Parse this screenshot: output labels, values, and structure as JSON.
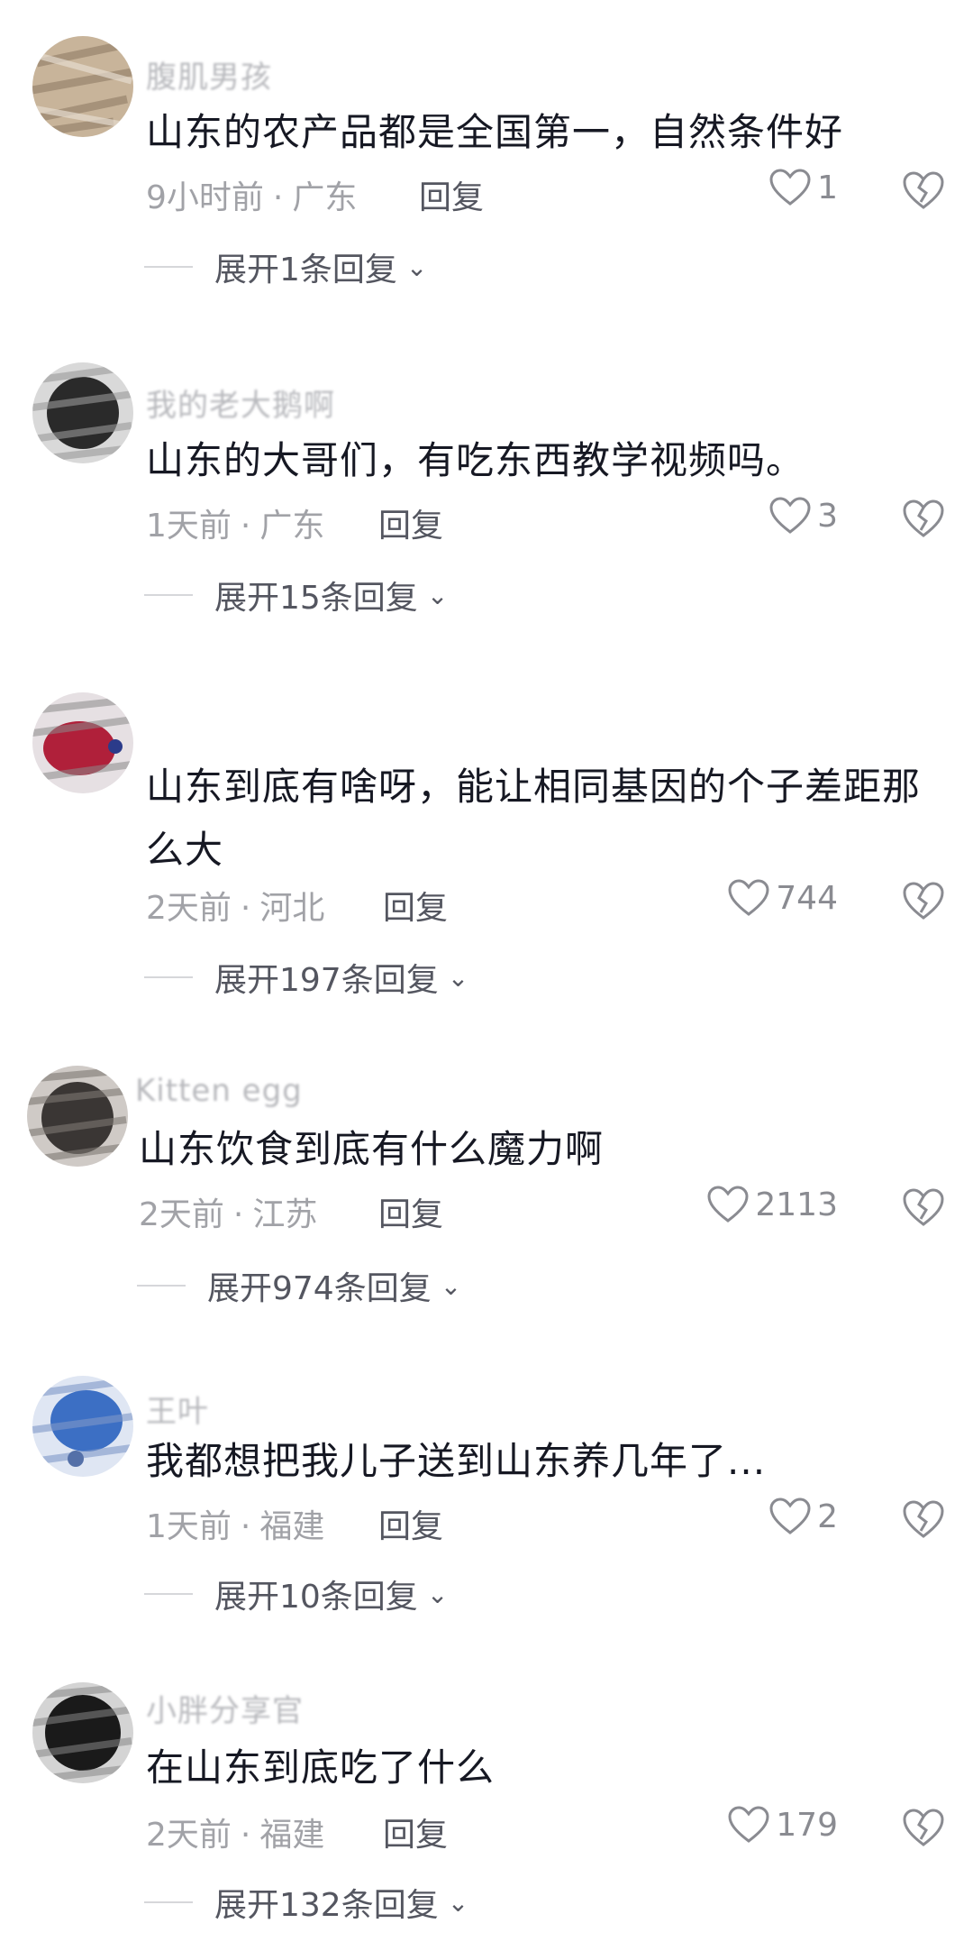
{
  "comments": [
    {
      "username": "腹肌男孩",
      "text": "山东的农产品都是全国第一，自然条件好",
      "time": "9小时前",
      "location": "广东",
      "reply_label": "回复",
      "likes": "1",
      "expand_label": "展开1条回复",
      "avatar_color": "#c8b49a"
    },
    {
      "username": "我的老大鹅啊",
      "text": "山东的大哥们，有吃东西教学视频吗。",
      "time": "1天前",
      "location": "广东",
      "reply_label": "回复",
      "likes": "3",
      "expand_label": "展开15条回复",
      "avatar_color": "#2a2a2a"
    },
    {
      "username": "",
      "text": "山东到底有啥呀，能让相同基因的个子差距那么大",
      "time": "2天前",
      "location": "河北",
      "reply_label": "回复",
      "likes": "744",
      "expand_label": "展开197条回复",
      "avatar_color": "#b0203a"
    },
    {
      "username": "Kitten egg",
      "text": "山东饮食到底有什么魔力啊",
      "time": "2天前",
      "location": "江苏",
      "reply_label": "回复",
      "likes": "2113",
      "expand_label": "展开974条回复",
      "avatar_color": "#3a3634"
    },
    {
      "username": "王叶",
      "text": "我都想把我儿子送到山东养几年了...",
      "time": "1天前",
      "location": "福建",
      "reply_label": "回复",
      "likes": "2",
      "expand_label": "展开10条回复",
      "avatar_color": "#3c6fc4"
    },
    {
      "username": "小胖分享官",
      "text": "在山东到底吃了什么",
      "time": "2天前",
      "location": "福建",
      "reply_label": "回复",
      "likes": "179",
      "expand_label": "展开132条回复",
      "avatar_color": "#1a1a1a"
    }
  ],
  "meta_separator": "·",
  "icons": {
    "like": "heart-outline-icon",
    "dislike": "broken-heart-icon",
    "expand": "chevron-down-icon"
  }
}
